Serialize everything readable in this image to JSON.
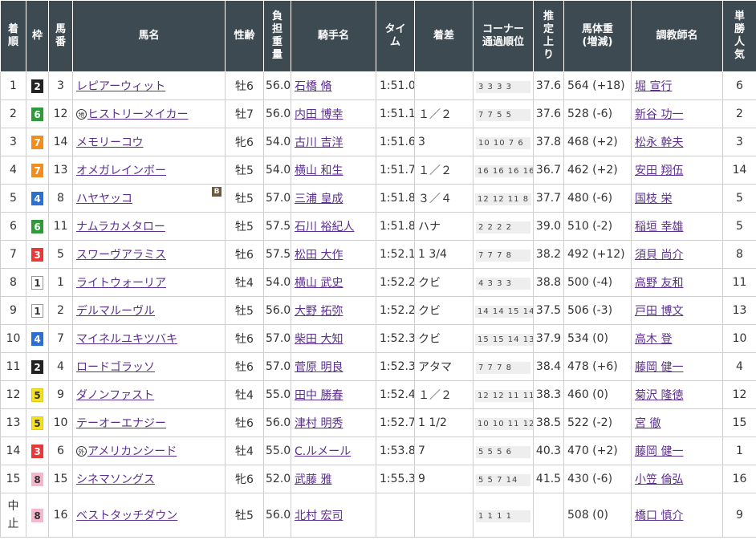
{
  "headers": [
    "着順",
    "枠",
    "馬番",
    "馬名",
    "性齢",
    "負担重量",
    "騎手名",
    "タイム",
    "着差",
    "コーナー通過順位",
    "推定上り",
    "馬体重(増減)",
    "調教師名",
    "単勝人気"
  ],
  "header_display": [
    "着\n順",
    "枠",
    "馬\n番",
    "馬名",
    "性齢",
    "負\n担\n重\n量",
    "騎手名",
    "タイ\nム",
    "着差",
    "コーナー\n通過順位",
    "推\n定\n上\nり",
    "馬体重\n(増減)",
    "調教師名",
    "単\n勝\n人\n気"
  ],
  "frame_colors": {
    "1": {
      "bg": "#ffffff",
      "fg": "#333333",
      "border": "#999999"
    },
    "2": {
      "bg": "#222222",
      "fg": "#ffffff",
      "border": "#222222"
    },
    "3": {
      "bg": "#e83838",
      "fg": "#ffffff",
      "border": "#e83838"
    },
    "4": {
      "bg": "#2a6fd6",
      "fg": "#ffffff",
      "border": "#2a6fd6"
    },
    "5": {
      "bg": "#f5e11e",
      "fg": "#333333",
      "border": "#e0cc00"
    },
    "6": {
      "bg": "#2e9a3a",
      "fg": "#ffffff",
      "border": "#2e9a3a"
    },
    "7": {
      "bg": "#f28c1c",
      "fg": "#ffffff",
      "border": "#f28c1c"
    },
    "8": {
      "bg": "#f7b6cc",
      "fg": "#333333",
      "border": "#f7b6cc"
    }
  },
  "rows": [
    {
      "rank": "1",
      "frame": "2",
      "num": "3",
      "mark": "",
      "horse": "レピアーウィット",
      "blinker": "",
      "sex_age": "牡6",
      "weight": "56.0",
      "jockey": "石橋 脩",
      "time": "1:51.0",
      "margin": "",
      "corner": "3 3 3 3",
      "last3f": "37.6",
      "body": "564 (+18)",
      "trainer": "堀 宣行",
      "pop": "6"
    },
    {
      "rank": "2",
      "frame": "6",
      "num": "12",
      "mark": "地",
      "horse": "ヒストリーメイカー",
      "blinker": "",
      "sex_age": "牡7",
      "weight": "56.0",
      "jockey": "内田 博幸",
      "time": "1:51.1",
      "margin": "１／２",
      "corner": "7 7 5 5",
      "last3f": "37.6",
      "body": "528 (-6)",
      "trainer": "新谷 功一",
      "pop": "2"
    },
    {
      "rank": "3",
      "frame": "7",
      "num": "14",
      "mark": "",
      "horse": "メモリーコウ",
      "blinker": "",
      "sex_age": "牝6",
      "weight": "54.0",
      "jockey": "古川 吉洋",
      "time": "1:51.6",
      "margin": "3",
      "corner": "10 10 7 6",
      "last3f": "37.8",
      "body": "468 (+2)",
      "trainer": "松永 幹夫",
      "pop": "3"
    },
    {
      "rank": "4",
      "frame": "7",
      "num": "13",
      "mark": "",
      "horse": "オメガレインボー",
      "blinker": "",
      "sex_age": "牡5",
      "weight": "54.0",
      "jockey": "横山 和生",
      "time": "1:51.7",
      "margin": "１／２",
      "corner": "16 16 16 16",
      "last3f": "36.7",
      "body": "462 (+2)",
      "trainer": "安田 翔伍",
      "pop": "14"
    },
    {
      "rank": "5",
      "frame": "4",
      "num": "8",
      "mark": "",
      "horse": "ハヤヤッコ",
      "blinker": "B",
      "sex_age": "牡5",
      "weight": "57.0",
      "jockey": "三浦 皇成",
      "time": "1:51.8",
      "margin": "３／４",
      "corner": "12 12 11 8",
      "last3f": "37.7",
      "body": "480 (-6)",
      "trainer": "国枝 栄",
      "pop": "5"
    },
    {
      "rank": "6",
      "frame": "6",
      "num": "11",
      "mark": "",
      "horse": "ナムラカメタロー",
      "blinker": "",
      "sex_age": "牡5",
      "weight": "57.5",
      "jockey": "石川 裕紀人",
      "time": "1:51.8",
      "margin": "ハナ",
      "corner": "2 2 2 2",
      "last3f": "39.0",
      "body": "510 (-2)",
      "trainer": "稲垣 幸雄",
      "pop": "5"
    },
    {
      "rank": "7",
      "frame": "3",
      "num": "5",
      "mark": "",
      "horse": "スワーヴアラミス",
      "blinker": "",
      "sex_age": "牡6",
      "weight": "57.5",
      "jockey": "松田 大作",
      "time": "1:52.1",
      "margin": "1 3/4",
      "corner": "7 7 7 8",
      "last3f": "38.2",
      "body": "492 (+12)",
      "trainer": "須貝 尚介",
      "pop": "8"
    },
    {
      "rank": "8",
      "frame": "1",
      "num": "1",
      "mark": "",
      "horse": "ライトウォーリア",
      "blinker": "",
      "sex_age": "牡4",
      "weight": "54.0",
      "jockey": "横山 武史",
      "time": "1:52.2",
      "margin": "クビ",
      "corner": "4 3 3 3",
      "last3f": "38.8",
      "body": "500 (-4)",
      "trainer": "高野 友和",
      "pop": "11"
    },
    {
      "rank": "9",
      "frame": "1",
      "num": "2",
      "mark": "",
      "horse": "デルマルーヴル",
      "blinker": "",
      "sex_age": "牡5",
      "weight": "56.0",
      "jockey": "大野 拓弥",
      "time": "1:52.2",
      "margin": "クビ",
      "corner": "14 14 15 14",
      "last3f": "37.5",
      "body": "506 (-3)",
      "trainer": "戸田 博文",
      "pop": "13"
    },
    {
      "rank": "10",
      "frame": "4",
      "num": "7",
      "mark": "",
      "horse": "マイネルユキツバキ",
      "blinker": "",
      "sex_age": "牡6",
      "weight": "57.0",
      "jockey": "柴田 大知",
      "time": "1:52.3",
      "margin": "クビ",
      "corner": "15 15 14 13",
      "last3f": "37.9",
      "body": "534 (0)",
      "trainer": "高木 登",
      "pop": "10"
    },
    {
      "rank": "11",
      "frame": "2",
      "num": "4",
      "mark": "",
      "horse": "ロードゴラッソ",
      "blinker": "",
      "sex_age": "牡6",
      "weight": "57.0",
      "jockey": "菅原 明良",
      "time": "1:52.3",
      "margin": "アタマ",
      "corner": "7 7 7 8",
      "last3f": "38.4",
      "body": "478 (+6)",
      "trainer": "藤岡 健一",
      "pop": "4"
    },
    {
      "rank": "12",
      "frame": "5",
      "num": "9",
      "mark": "",
      "horse": "ダノンファスト",
      "blinker": "",
      "sex_age": "牡4",
      "weight": "55.0",
      "jockey": "田中 勝春",
      "time": "1:52.4",
      "margin": "１／２",
      "corner": "12 12 11 11",
      "last3f": "38.3",
      "body": "460 (0)",
      "trainer": "菊沢 隆徳",
      "pop": "12"
    },
    {
      "rank": "13",
      "frame": "5",
      "num": "10",
      "mark": "",
      "horse": "テーオーエナジー",
      "blinker": "",
      "sex_age": "牡6",
      "weight": "56.0",
      "jockey": "津村 明秀",
      "time": "1:52.7",
      "margin": "1 1/2",
      "corner": "10 10 11 12",
      "last3f": "38.5",
      "body": "522 (-2)",
      "trainer": "宮 徹",
      "pop": "15"
    },
    {
      "rank": "14",
      "frame": "3",
      "num": "6",
      "mark": "外",
      "horse": "アメリカンシード",
      "blinker": "",
      "sex_age": "牡4",
      "weight": "55.0",
      "jockey": "C.ルメール",
      "time": "1:53.8",
      "margin": "7",
      "corner": "5 5 5 6",
      "last3f": "40.3",
      "body": "470 (+2)",
      "trainer": "藤岡 健一",
      "pop": "1"
    },
    {
      "rank": "15",
      "frame": "8",
      "num": "15",
      "mark": "",
      "horse": "シネマソングス",
      "blinker": "",
      "sex_age": "牝6",
      "weight": "52.0",
      "jockey": "武藤 雅",
      "time": "1:55.3",
      "margin": "9",
      "corner": "5 5 7 14",
      "last3f": "41.5",
      "body": "430 (-6)",
      "trainer": "小笠 倫弘",
      "pop": "16"
    },
    {
      "rank": "中止",
      "frame": "8",
      "num": "16",
      "mark": "",
      "horse": "ベストタッチダウン",
      "blinker": "",
      "sex_age": "牡5",
      "weight": "56.0",
      "jockey": "北村 宏司",
      "time": "",
      "margin": "",
      "corner": "1 1 1 1",
      "last3f": "",
      "body": "508 (0)",
      "trainer": "橋口 慎介",
      "pop": "9"
    }
  ]
}
